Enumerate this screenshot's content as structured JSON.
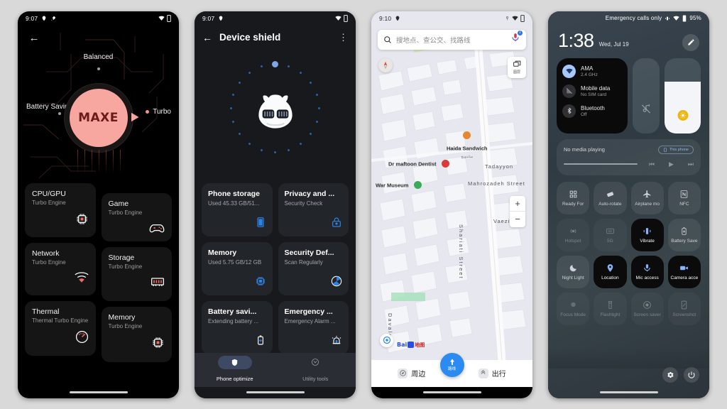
{
  "background_color": "#d9d9d9",
  "phone1": {
    "status": {
      "time": "9:07",
      "icons": [
        "location-icon",
        "rocket-icon",
        "wifi-icon",
        "battery-icon"
      ]
    },
    "back_label": "←",
    "dial": {
      "brand": "MAXE",
      "mode_top": "Balanced",
      "mode_left": "Battery Saving",
      "mode_right": "Turbo",
      "accent": "#f7a7a0",
      "brand_color": "#6e1a18"
    },
    "cards_left": [
      {
        "title": "CPU/GPU",
        "sub": "Turbo Engine",
        "icon": "cpu-chip-icon"
      },
      {
        "title": "Network",
        "sub": "Turbo Engine",
        "icon": "wifi-signal-icon"
      },
      {
        "title": "Thermal",
        "sub": "Thermal Turbo Engine",
        "icon": "thermometer-gauge-icon"
      }
    ],
    "cards_right": [
      {
        "title": "Game",
        "sub": "Turbo Engine",
        "icon": "gamepad-icon"
      },
      {
        "title": "Storage",
        "sub": "Turbo Engine",
        "icon": "storage-chip-icon"
      },
      {
        "title": "Memory",
        "sub": "Turbo Engine",
        "icon": "memory-chip-icon"
      }
    ]
  },
  "phone2": {
    "status": {
      "time": "9:07",
      "icons": [
        "location-icon",
        "wifi-icon",
        "battery-icon"
      ]
    },
    "title": "Device shield",
    "back_label": "←",
    "menu_label": "⋮",
    "cards": [
      {
        "title": "Phone storage",
        "sub": "Used 45.33 GB/51...",
        "icon": "phone-storage-icon"
      },
      {
        "title": "Privacy and ...",
        "sub": "Security Check",
        "icon": "lock-icon"
      },
      {
        "title": "Memory",
        "sub": "Used 5.75 GB/12 GB",
        "icon": "memory-chip-icon"
      },
      {
        "title": "Security Def...",
        "sub": "Scan Regularly",
        "icon": "radar-scan-icon"
      },
      {
        "title": "Battery savi...",
        "sub": "Extending battery ...",
        "icon": "battery-plus-icon"
      },
      {
        "title": "Emergency ...",
        "sub": "Emergency Alarm ...",
        "icon": "alarm-siren-icon"
      }
    ],
    "nav": [
      {
        "label": "Phone optimize",
        "icon": "shield-icon",
        "active": true
      },
      {
        "label": "Utility tools",
        "icon": "tools-badge-icon",
        "active": false
      }
    ]
  },
  "phone3": {
    "status": {
      "time": "9:10",
      "icons": [
        "location-icon",
        "gps-icon",
        "wifi-icon",
        "battery-icon"
      ]
    },
    "search": {
      "placeholder": "搜地点、查公交、找路线",
      "icon": "search-icon",
      "mic_icon": "mic-icon",
      "mic_badge": "1"
    },
    "layers_button": {
      "label": "图层",
      "icon": "layers-icon"
    },
    "zoom_in": "+",
    "zoom_out": "−",
    "attribution": {
      "latin": "Bai",
      "cn": "地图"
    },
    "pois": [
      {
        "name": "Haida Sandwich",
        "sub": "ساندویچ",
        "color": "#e8872e"
      },
      {
        "name": "Dr maftoon Dentist",
        "color": "#d93a3a"
      },
      {
        "name": "War Museum",
        "color": "#3bab5a"
      }
    ],
    "streets": [
      "Tadayyon",
      "Mahrozadeh Street",
      "Vaezi Str",
      "Shariati Street",
      "Davalo"
    ],
    "nav": [
      {
        "label": "周边",
        "icon": "compass-icon"
      },
      {
        "label": "路线",
        "icon": "route-arrow-icon",
        "center": true
      },
      {
        "label": "出行",
        "icon": "transit-icon"
      }
    ]
  },
  "phone4": {
    "status": {
      "text": "Emergency calls only",
      "battery": "95%",
      "icons": [
        "vibrate-icon",
        "wifi-icon",
        "battery-icon"
      ]
    },
    "clock": {
      "time": "1:38",
      "date": "Wed, Jul 19"
    },
    "edit_icon": "pencil-icon",
    "internet": [
      {
        "name": "AMA",
        "sub": "2.4 GHz",
        "icon": "wifi-icon",
        "active": true
      },
      {
        "name": "Mobile data",
        "sub": "No SIM card",
        "icon": "mobile-data-off-icon",
        "active": false
      },
      {
        "name": "Bluetooth",
        "sub": "Off",
        "icon": "bluetooth-icon",
        "active": false
      }
    ],
    "volume_slider": {
      "icon": "mute-icon"
    },
    "brightness_slider": {
      "icon": "brightness-icon",
      "level": 68
    },
    "media": {
      "title": "No media playing",
      "chip": "This phone",
      "chip_icon": "phone-icon",
      "controls": [
        "prev-icon",
        "play-icon",
        "next-icon"
      ]
    },
    "tiles": [
      {
        "label": "Ready For",
        "icon": "grid-squares-icon",
        "on": false
      },
      {
        "label": "Auto-rotate",
        "icon": "rotate-icon",
        "on": false
      },
      {
        "label": "Airplane mo",
        "icon": "airplane-icon",
        "on": false
      },
      {
        "label": "NFC",
        "icon": "nfc-icon",
        "on": false
      },
      {
        "label": "Hotspot",
        "icon": "hotspot-icon",
        "on": false
      },
      {
        "label": "5G",
        "icon": "5g-icon",
        "on": false
      },
      {
        "label": "Vibrate",
        "icon": "vibrate-icon",
        "on": true
      },
      {
        "label": "Battery Save",
        "icon": "battery-saver-icon",
        "on": false
      },
      {
        "label": "Night Light",
        "icon": "moon-icon",
        "on": false
      },
      {
        "label": "Location",
        "icon": "location-pin-icon",
        "on": true
      },
      {
        "label": "Mic access",
        "icon": "mic-icon",
        "on": true
      },
      {
        "label": "Camera acce",
        "icon": "camera-icon",
        "on": true
      },
      {
        "label": "Focus Mode",
        "icon": "focus-icon",
        "on": false
      },
      {
        "label": "Flashlight",
        "icon": "flashlight-icon",
        "on": false
      },
      {
        "label": "Screen saver",
        "icon": "screensaver-icon",
        "on": false
      },
      {
        "label": "Screenshot",
        "icon": "screenshot-icon",
        "on": false
      }
    ],
    "footer": [
      {
        "icon": "gear-icon",
        "name": "settings"
      },
      {
        "icon": "power-icon",
        "name": "power"
      }
    ]
  }
}
